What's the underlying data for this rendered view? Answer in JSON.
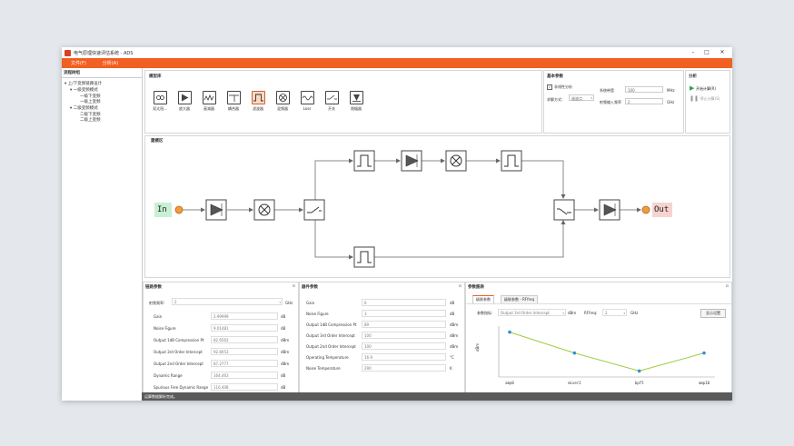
{
  "window": {
    "title": "电气原理快速评估系统 - ADS"
  },
  "menu": [
    "文件(F)",
    "分析(A)"
  ],
  "tree": {
    "header": "流程树组",
    "nodes": [
      "上/下变频链路设计",
      "一级变频模式",
      "一级下变频",
      "一级上变频",
      "二级变频模式",
      "二级下变频",
      "二级上变频"
    ]
  },
  "library": {
    "header": "模型库",
    "items": [
      "双太阳...",
      "放大器",
      "衰减器",
      "耦合器",
      "滤波器",
      "混频器",
      "Loss",
      "开关",
      "限幅器"
    ],
    "selected_index": 4
  },
  "basic": {
    "header": "基本参数",
    "checkbox_label": "非线性分析",
    "method_label": "求解方式:",
    "method_value": "谐波点",
    "bw_label": "系统带宽",
    "bw_value": "100",
    "bw_unit": "MHz",
    "freq_label": "射频输入频率",
    "freq_value": "2",
    "freq_unit": "GHz"
  },
  "analysis": {
    "header": "分析",
    "start": "开始计算(R)",
    "stop": "停止计算(S)"
  },
  "canvas": {
    "title": "建模区",
    "in_label": "In",
    "out_label": "Out"
  },
  "link_params": {
    "header": "链路参数",
    "freq_label": "射频频率:",
    "freq_value": "2",
    "freq_unit": "GHz",
    "rows": [
      {
        "label": "Gain",
        "value": "2.99999",
        "unit": "dB"
      },
      {
        "label": "Noise Figure",
        "value": "9.01481",
        "unit": "dB"
      },
      {
        "label": "Output 1dB Compression Pt",
        "value": "82.6562",
        "unit": "dBm"
      },
      {
        "label": "Output 3rd Order Intercept",
        "value": "92.8053",
        "unit": "dBm"
      },
      {
        "label": "Output 2nd Order Intercept",
        "value": "87.2777",
        "unit": "dBm"
      },
      {
        "label": "Dynamic Range",
        "value": "164.463",
        "unit": "dB"
      },
      {
        "label": "Spurious Free Dynamic Range",
        "value": "116.408",
        "unit": "dB"
      }
    ]
  },
  "component_params": {
    "header": "器件参数",
    "rows": [
      {
        "label": "Gain",
        "value": "6",
        "unit": "dB"
      },
      {
        "label": "Noise Figure",
        "value": "3",
        "unit": "dB"
      },
      {
        "label": "Output 1dB Compression Pt",
        "value": "89",
        "unit": "dBm"
      },
      {
        "label": "Output 3rd Order Intercept",
        "value": "100",
        "unit": "dBm"
      },
      {
        "label": "Output 2nd Order Intercept",
        "value": "100",
        "unit": "dBm"
      },
      {
        "label": "Operating Temperature",
        "value": "16.9",
        "unit": "°C"
      },
      {
        "label": "Noise Temperature",
        "value": "290",
        "unit": "K"
      }
    ]
  },
  "chart_panel": {
    "header": "参数图表",
    "tabs": [
      "级联参数",
      "级联参数 - RFfreq"
    ],
    "param_label": "参数指标:",
    "param_value": "Output 3rd Order Intercept",
    "param_unit": "dBm",
    "rf_label": "RFfreq:",
    "rf_value": "2",
    "rf_unit": "GHz",
    "settings_btn": "显示设置"
  },
  "chart_data": {
    "type": "line",
    "categories": [
      "amp0",
      "mixer2",
      "bpf5",
      "amp10"
    ],
    "values": [
      103,
      96,
      90,
      96
    ],
    "ylabel": "dBm",
    "ylim": [
      88,
      105
    ],
    "color": "#9ccc3c",
    "point_color": "#2f8fd8"
  },
  "status": {
    "text": "运算数据解析完成。"
  },
  "colors": {
    "accent": "#f25f22",
    "run_green": "#2fa24a",
    "port_orange": "#f39a3c"
  }
}
